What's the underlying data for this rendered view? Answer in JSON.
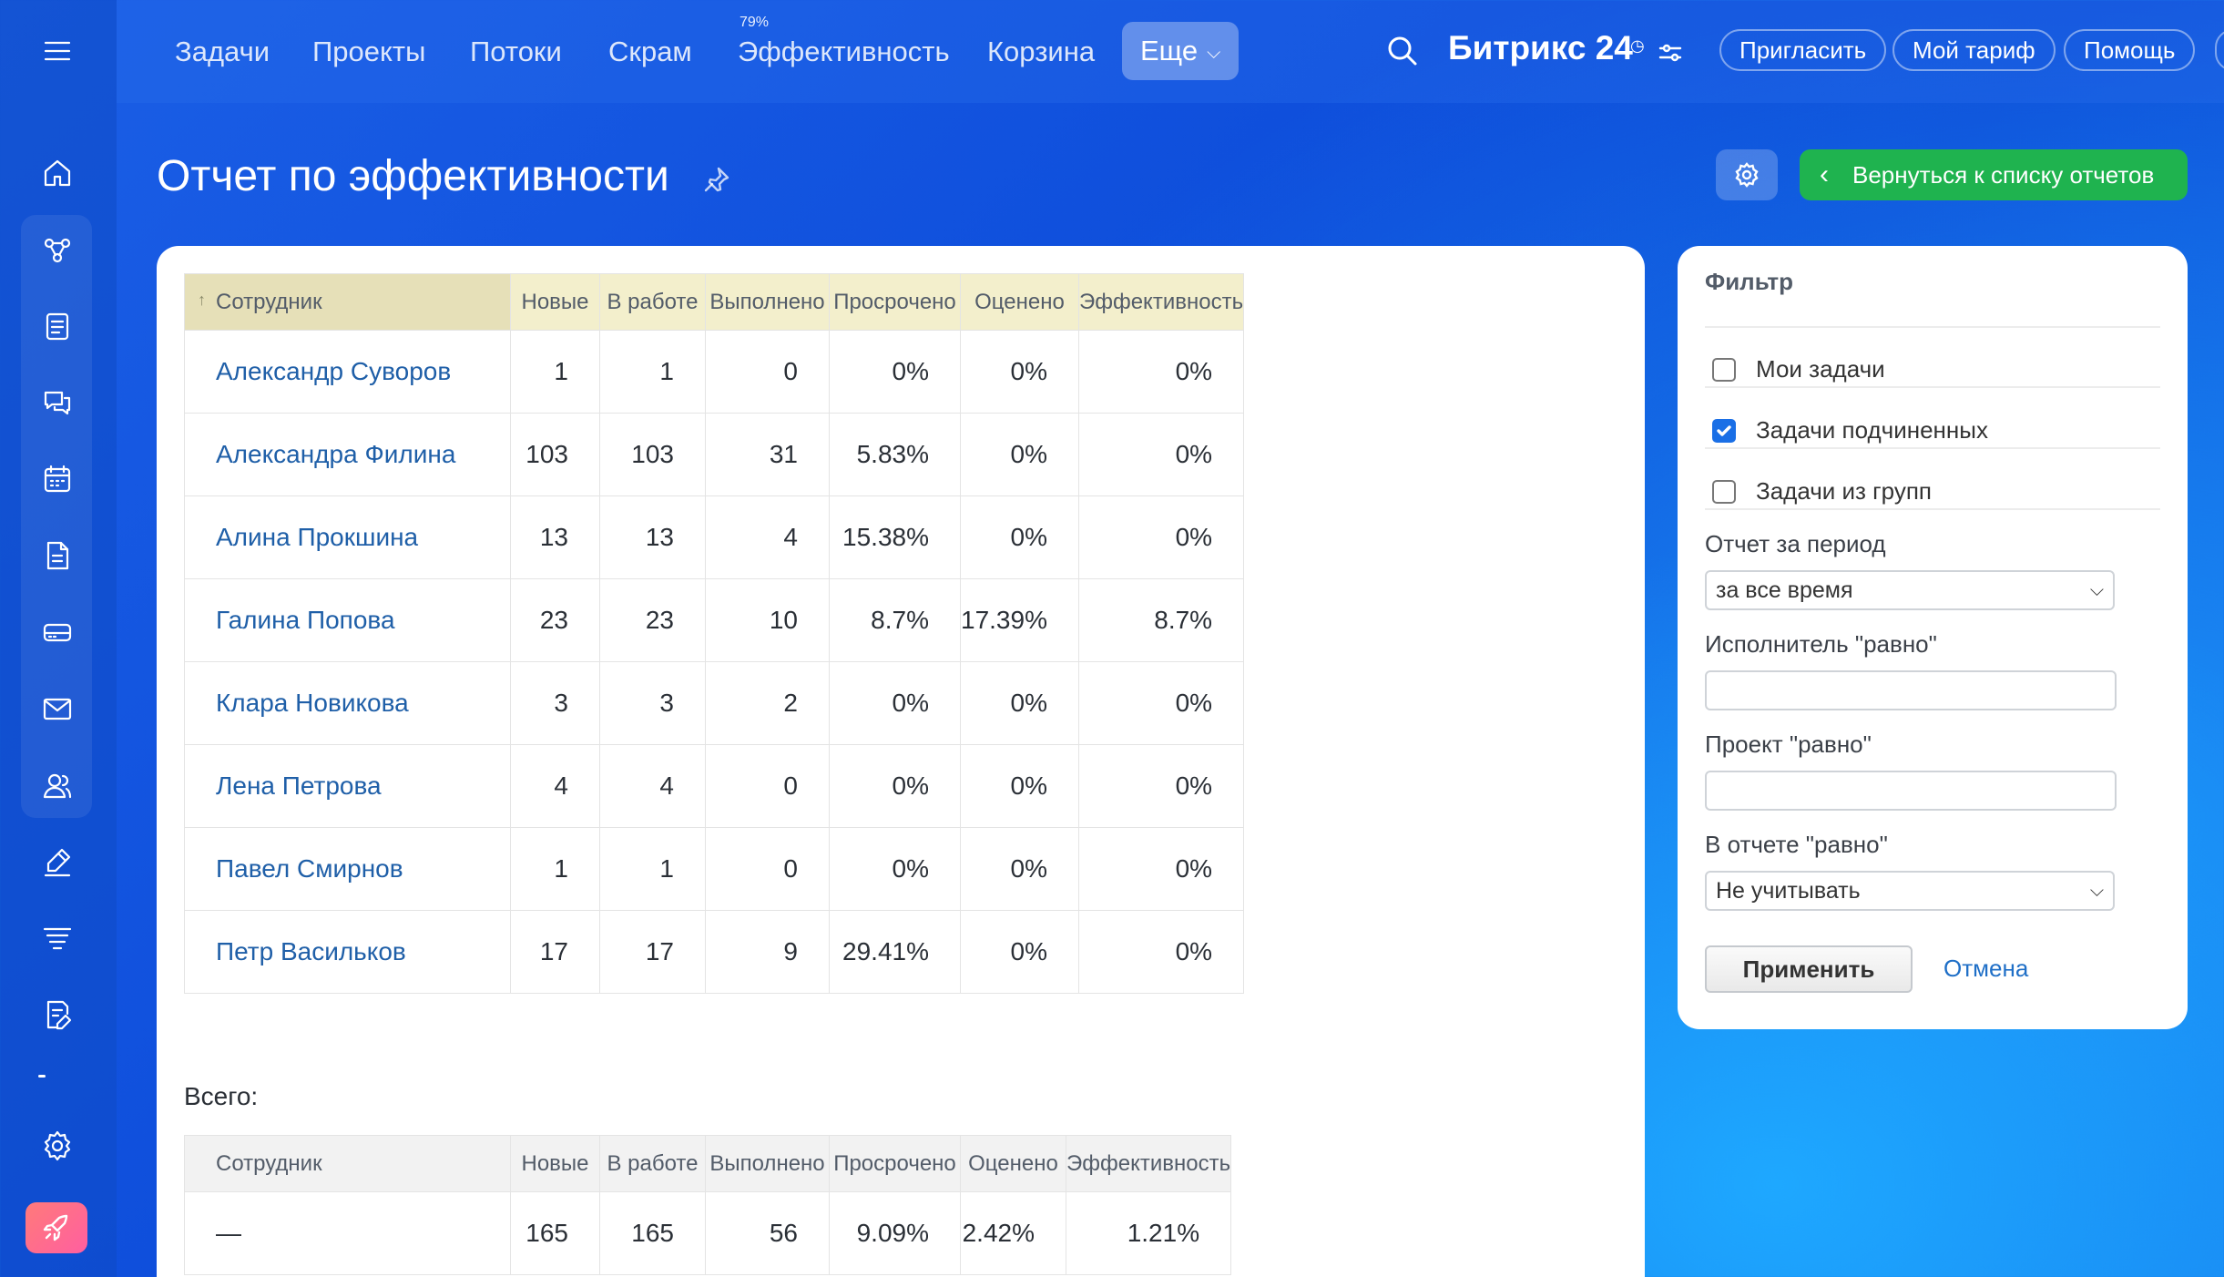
{
  "topnav": {
    "items": [
      "Задачи",
      "Проекты",
      "Потоки",
      "Скрам",
      "Эффективность",
      "Корзина"
    ],
    "more_label": "Еще",
    "efficiency_badge": "79%",
    "brand": "Битрикс 24",
    "invite_label": "Пригласить",
    "tariff_label": "Мой тариф",
    "help_label": "Помощь"
  },
  "sidebar": {
    "icons": [
      "menu-icon",
      "home-icon",
      "flow-icon",
      "tasks-icon",
      "chat-icon",
      "calendar-icon",
      "document-icon",
      "drive-icon",
      "mail-icon",
      "contacts-icon",
      "sign-icon",
      "funnel-icon",
      "edit-list-icon",
      "settings-icon",
      "rocket-icon"
    ]
  },
  "header": {
    "title": "Отчет по эффективности",
    "back_label": "Вернуться к списку отчетов"
  },
  "report": {
    "columns": [
      "Сотрудник",
      "Новые",
      "В работе",
      "Выполнено",
      "Просрочено",
      "Оценено",
      "Эффективность"
    ],
    "rows": [
      {
        "name": "Александр Суворов",
        "new": "1",
        "in_work": "1",
        "done": "0",
        "overdue": "0%",
        "rated": "0%",
        "efficiency": "0%"
      },
      {
        "name": "Александра Филина",
        "new": "103",
        "in_work": "103",
        "done": "31",
        "overdue": "5.83%",
        "rated": "0%",
        "efficiency": "0%"
      },
      {
        "name": "Алина Прокшина",
        "new": "13",
        "in_work": "13",
        "done": "4",
        "overdue": "15.38%",
        "rated": "0%",
        "efficiency": "0%"
      },
      {
        "name": "Галина Попова",
        "new": "23",
        "in_work": "23",
        "done": "10",
        "overdue": "8.7%",
        "rated": "17.39%",
        "efficiency": "8.7%"
      },
      {
        "name": "Клара Новикова",
        "new": "3",
        "in_work": "3",
        "done": "2",
        "overdue": "0%",
        "rated": "0%",
        "efficiency": "0%"
      },
      {
        "name": "Лена Петрова",
        "new": "4",
        "in_work": "4",
        "done": "0",
        "overdue": "0%",
        "rated": "0%",
        "efficiency": "0%"
      },
      {
        "name": "Павел Смирнов",
        "new": "1",
        "in_work": "1",
        "done": "0",
        "overdue": "0%",
        "rated": "0%",
        "efficiency": "0%"
      },
      {
        "name": "Петр Васильков",
        "new": "17",
        "in_work": "17",
        "done": "9",
        "overdue": "29.41%",
        "rated": "0%",
        "efficiency": "0%"
      }
    ],
    "total_label": "Всего:",
    "total_row": {
      "name": "—",
      "new": "165",
      "in_work": "165",
      "done": "56",
      "overdue": "9.09%",
      "rated": "2.42%",
      "efficiency": "1.21%"
    }
  },
  "filter": {
    "title": "Фильтр",
    "checks": [
      {
        "label": "Мои задачи",
        "checked": false
      },
      {
        "label": "Задачи подчиненных",
        "checked": true
      },
      {
        "label": "Задачи из групп",
        "checked": false
      }
    ],
    "period_label": "Отчет за период",
    "period_value": "за все время",
    "executor_label": "Исполнитель \"равно\"",
    "executor_value": "",
    "project_label": "Проект \"равно\"",
    "project_value": "",
    "in_report_label": "В отчете \"равно\"",
    "in_report_value": "Не учитывать",
    "apply_label": "Применить",
    "cancel_label": "Отмена"
  },
  "colors": {
    "accent_green": "#1fb34f",
    "link_blue": "#1f5fa8",
    "header_sorted": "#e6e0b8",
    "header_bg": "#f3efcc"
  }
}
